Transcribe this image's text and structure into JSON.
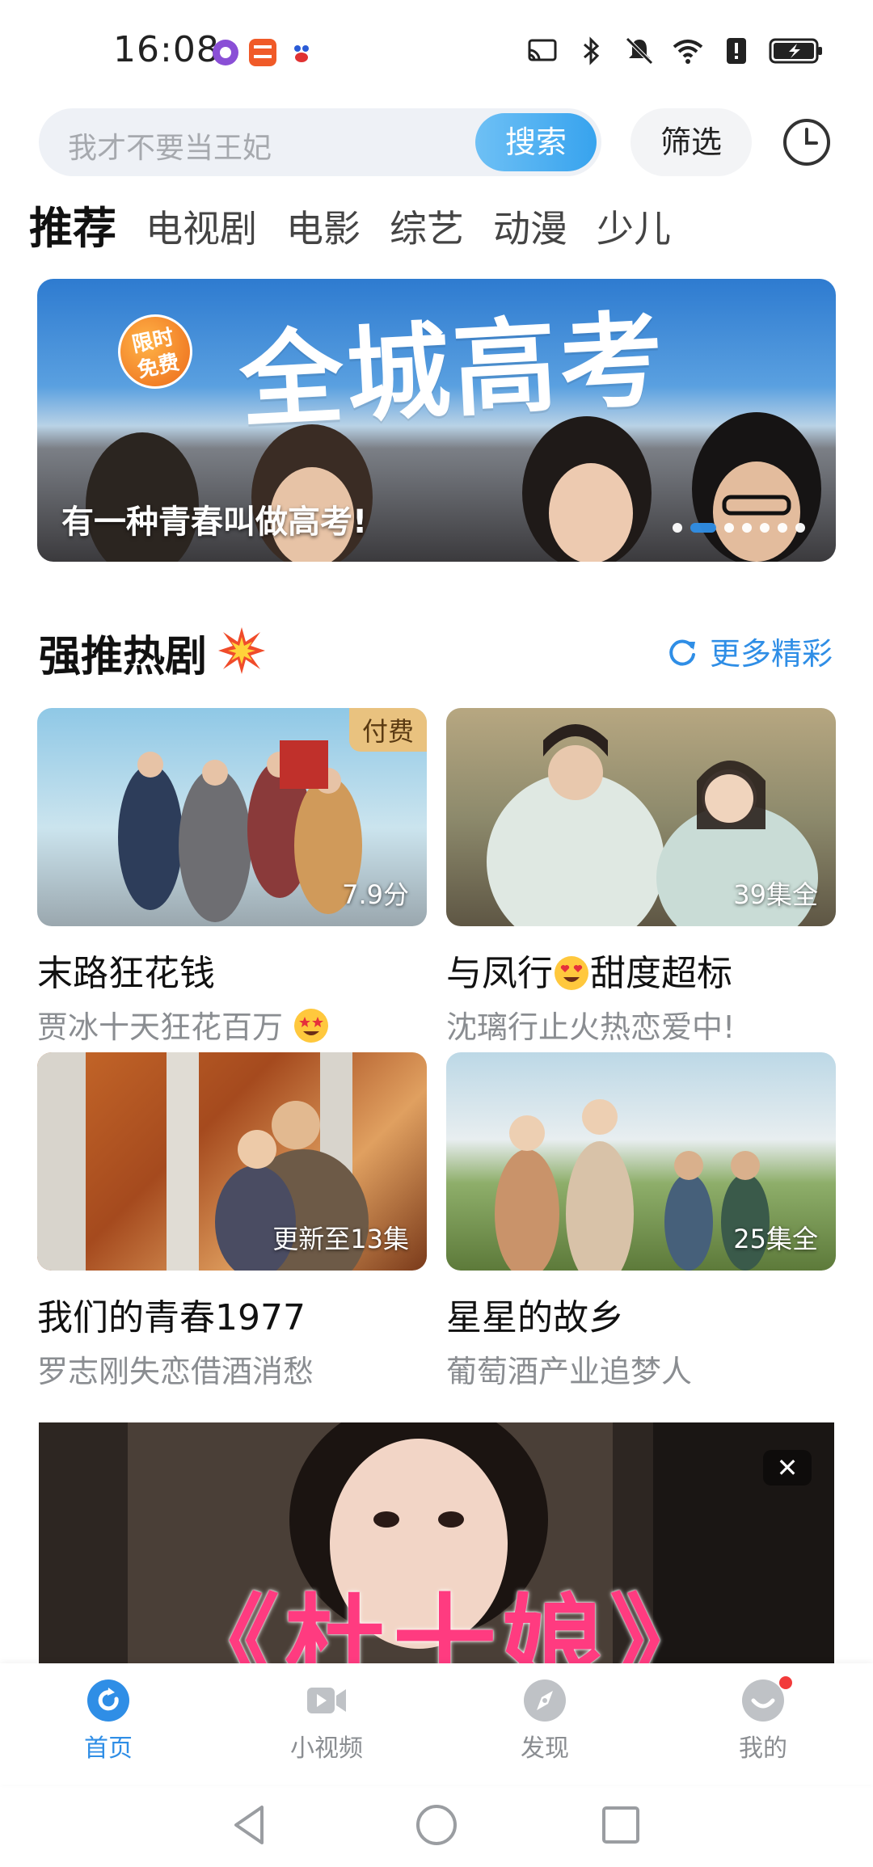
{
  "status": {
    "time": "16:08"
  },
  "search": {
    "placeholder": "我才不要当王妃",
    "search_label": "搜索",
    "filter_label": "筛选"
  },
  "tabs": [
    {
      "label": "推荐",
      "active": true
    },
    {
      "label": "电视剧",
      "active": false
    },
    {
      "label": "电影",
      "active": false
    },
    {
      "label": "综艺",
      "active": false
    },
    {
      "label": "动漫",
      "active": false
    },
    {
      "label": "少儿",
      "active": false
    }
  ],
  "banner": {
    "title": "全城高考",
    "badge": "限时 免费",
    "caption": "有一种青春叫做高考!",
    "slide_count": 7,
    "active_slide": 2
  },
  "section": {
    "title": "强推热剧",
    "more_label": "更多精彩"
  },
  "cards": [
    {
      "title": "末路狂花钱",
      "subtitle": "贾冰十天狂花百万",
      "badge": "付费",
      "meta": "7.9分",
      "emoji": "star-struck-icon"
    },
    {
      "title": "与凤行",
      "title_suffix": "甜度超标",
      "subtitle": "沈璃行止火热恋爱中!",
      "meta": "39集全",
      "emoji": "heart-eyes-icon"
    },
    {
      "title": "我们的青春1977",
      "subtitle": "罗志刚失恋借酒消愁",
      "meta": "更新至13集"
    },
    {
      "title": "星星的故乡",
      "subtitle": "葡萄酒产业追梦人",
      "meta": "25集全"
    }
  ],
  "ad": {
    "title": "《杜十娘》",
    "close": "✕"
  },
  "bottom_nav": [
    {
      "label": "首页",
      "active": true
    },
    {
      "label": "小视频",
      "active": false
    },
    {
      "label": "发现",
      "active": false
    },
    {
      "label": "我的",
      "active": false
    }
  ],
  "colors": {
    "accent": "#2f8ee6",
    "badge": "#e9c27f",
    "ad_title": "#ff3b80"
  }
}
